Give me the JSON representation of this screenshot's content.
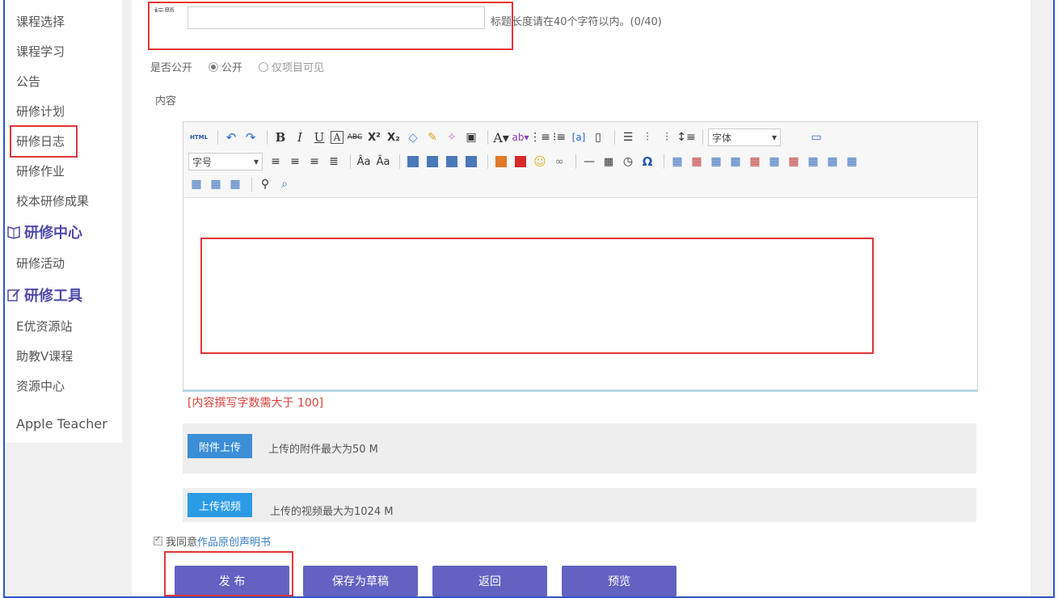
{
  "sidebar": {
    "items": [
      {
        "label": "课程选择"
      },
      {
        "label": "课程学习"
      },
      {
        "label": "公告"
      },
      {
        "label": "研修计划"
      },
      {
        "label": "研修日志"
      },
      {
        "label": "研修作业"
      },
      {
        "label": "校本研修成果"
      }
    ],
    "heading_center": "研修中心",
    "items2": [
      {
        "label": "研修活动"
      }
    ],
    "heading_tools": "研修工具",
    "items3": [
      {
        "label": "E优资源站"
      },
      {
        "label": "助教V课程"
      },
      {
        "label": "资源中心"
      },
      {
        "label": "Apple Teacher"
      }
    ]
  },
  "form": {
    "title_label": "标题",
    "title_hint": "标题长度请在40个字符以内。(0/40)",
    "public_label": "是否公开",
    "public_option": "公开",
    "project_option": "仅项目可见",
    "content_label": "内容",
    "font_placeholder": "字体",
    "size_placeholder": "字号",
    "html_btn": "HTML",
    "content_hint": "[内容撰写字数需大于 100]",
    "attach_button": "附件上传",
    "attach_note": "上传的附件最大为50 M",
    "video_button": "上传视频",
    "video_note": "上传的视频最大为1024 M",
    "agree_text": "我同意",
    "agree_link": "作品原创声明书"
  },
  "actions": {
    "publish": "发 布",
    "save_draft": "保存为草稿",
    "back": "返回",
    "preview": "预览"
  },
  "colors": {
    "accent": "#6262c2",
    "upload_blue": "#3b8fd6",
    "video_blue": "#2b9be6",
    "annotation_red": "#e1363a",
    "heading_purple": "#4e4aa8"
  }
}
